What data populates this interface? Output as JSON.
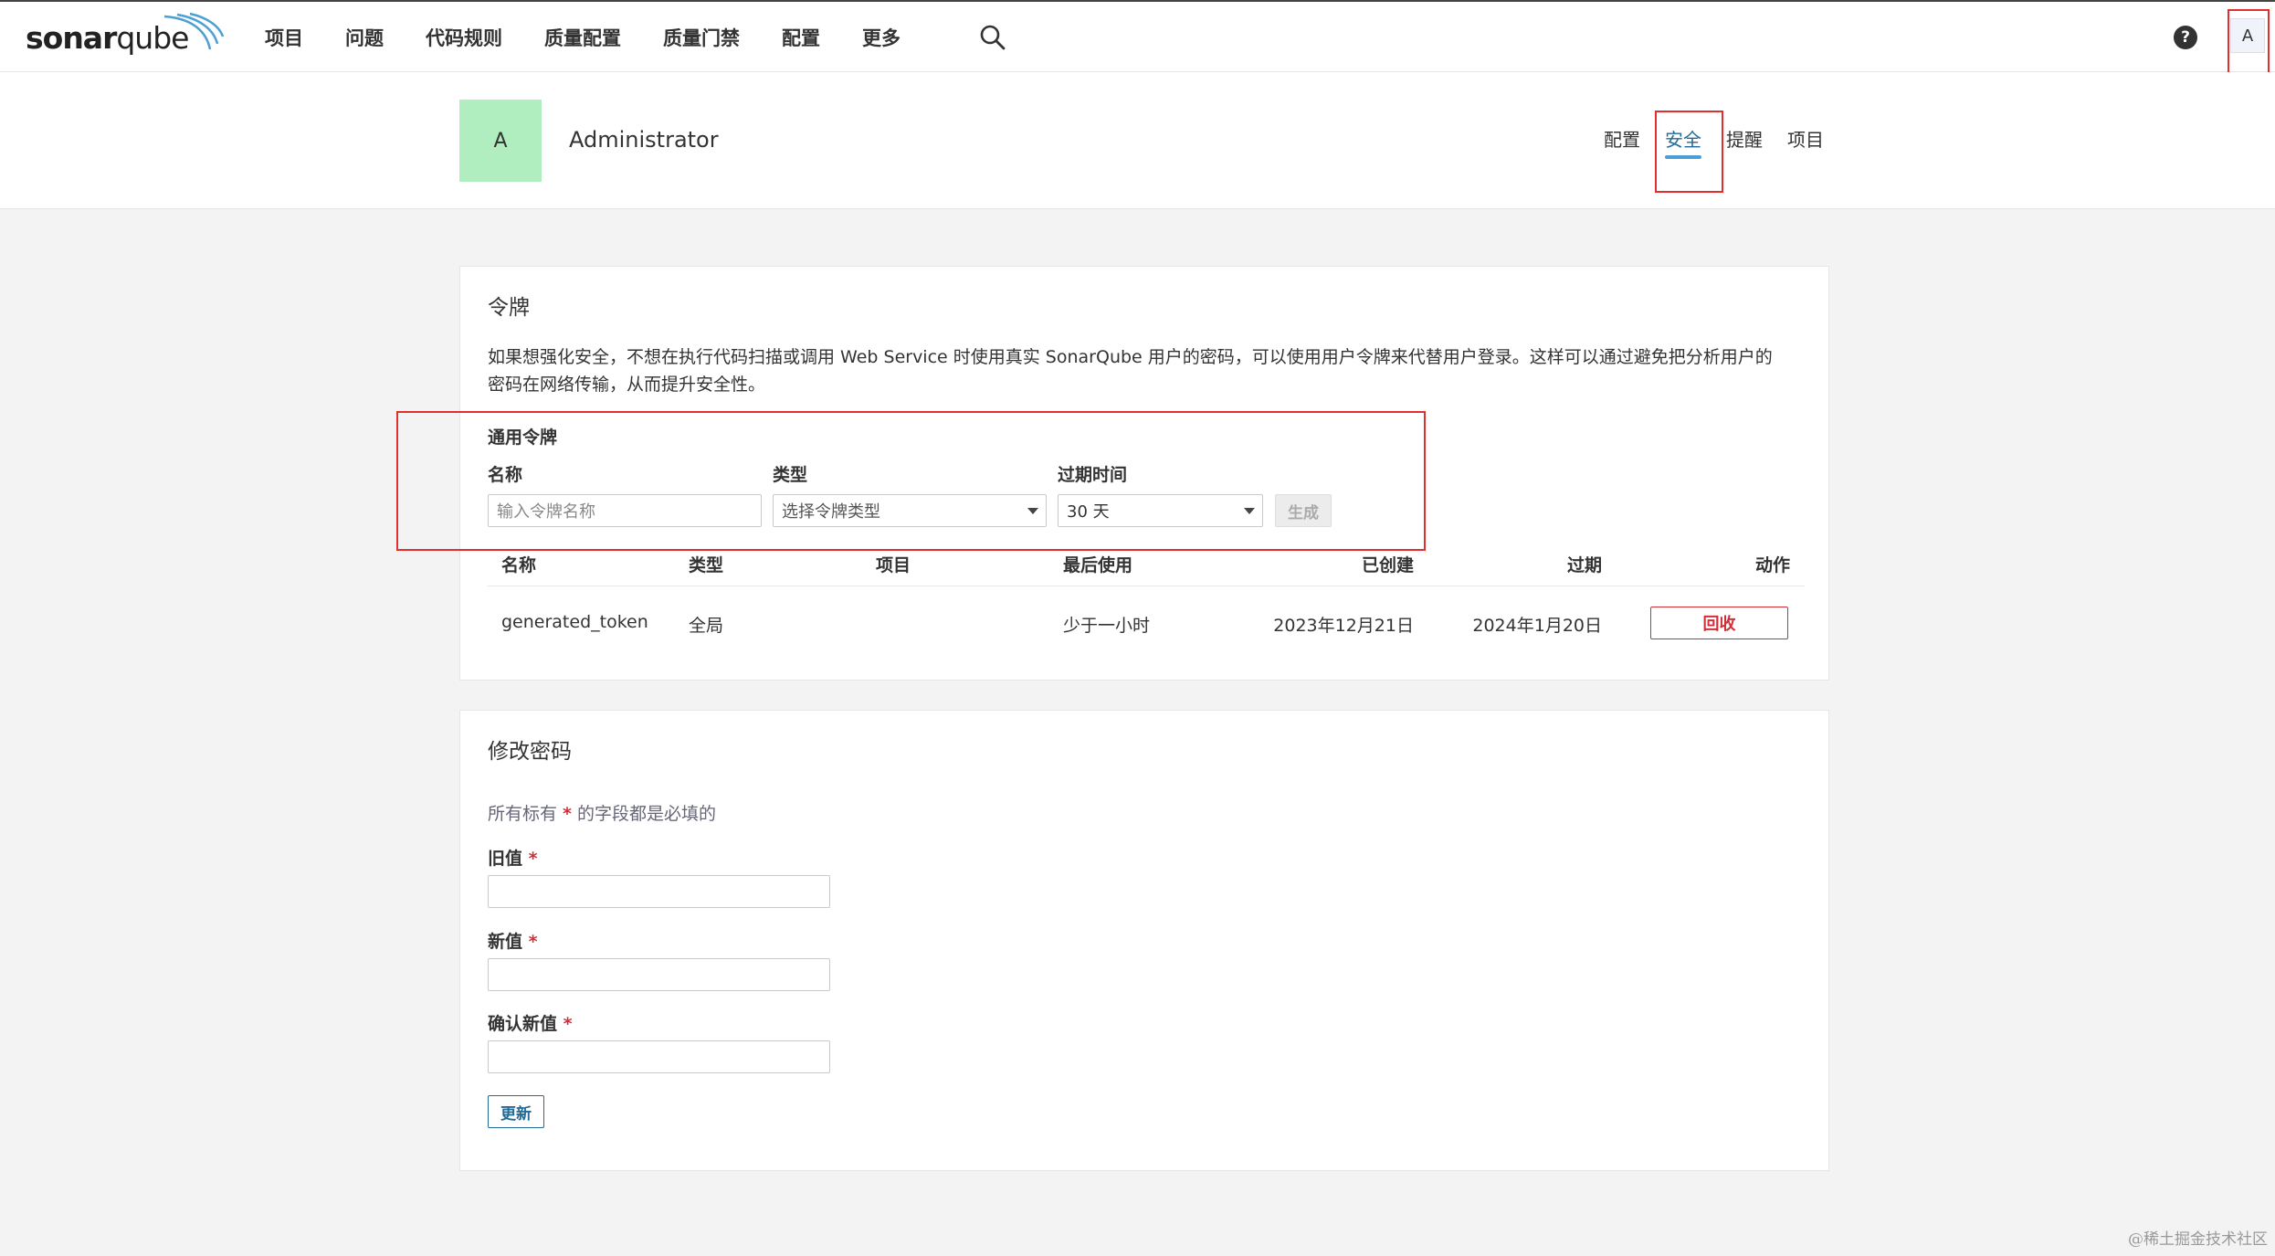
{
  "app": {
    "logo_left": "sonar",
    "logo_right": "qube"
  },
  "nav": {
    "items": [
      "项目",
      "问题",
      "代码规则",
      "质量配置",
      "质量门禁",
      "配置",
      "更多"
    ]
  },
  "topbar": {
    "help": "?",
    "avatar": "A"
  },
  "user": {
    "avatar_letter": "A",
    "name": "Administrator",
    "tabs": [
      "配置",
      "安全",
      "提醒",
      "项目"
    ],
    "active_tab": "安全"
  },
  "tokens": {
    "title": "令牌",
    "description": "如果想强化安全，不想在执行代码扫描或调用 Web Service 时使用真实 SonarQube 用户的密码，可以使用用户令牌来代替用户登录。这样可以通过避免把分析用户的密码在网络传输，从而提升安全性。",
    "form_title": "通用令牌",
    "name_label": "名称",
    "type_label": "类型",
    "expiry_label": "过期时间",
    "name_placeholder": "输入令牌名称",
    "type_placeholder": "选择令牌类型",
    "expiry_value": "30 天",
    "generate_button": "生成",
    "table_headers": [
      "名称",
      "类型",
      "项目",
      "最后使用",
      "已创建",
      "过期",
      "动作"
    ],
    "rows": [
      {
        "name": "generated_token",
        "type": "全局",
        "project": "",
        "last_used": "少于一小时",
        "created": "2023年12月21日",
        "expires": "2024年1月20日",
        "action": "回收"
      }
    ]
  },
  "password": {
    "title": "修改密码",
    "required_note_prefix": "所有标有 ",
    "required_star": "*",
    "required_note_suffix": " 的字段都是必填的",
    "old_label": "旧值",
    "new_label": "新值",
    "confirm_label": "确认新值",
    "update_button": "更新"
  },
  "watermark": "@稀土掘金技术社区",
  "colors": {
    "accent": "#4b9fd5",
    "danger": "#d02f3a",
    "highlight": "#e02f2f",
    "avatar_bg": "#b0eec0"
  }
}
